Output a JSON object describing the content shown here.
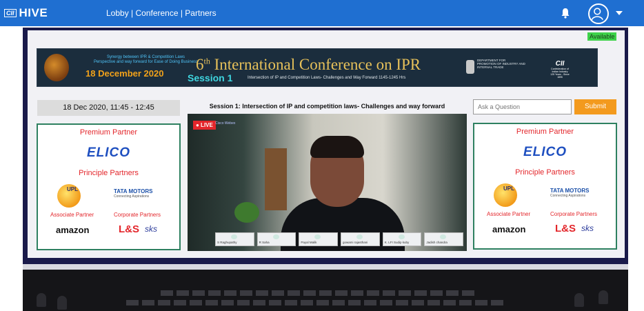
{
  "app": {
    "logo_mark": "CII",
    "logo_text": "HIVE",
    "nav": "Lobby | Conference | Partners"
  },
  "header": {
    "bell_icon": "bell-icon",
    "avatar_icon": "user-avatar-icon",
    "menu_icon": "caret-down-icon"
  },
  "status": {
    "available": "Available"
  },
  "banner": {
    "synergy_line1": "Synergy between IPR & Competition Laws",
    "synergy_line2": "Perspective and way forward for Ease of Doing Business",
    "date": "18 December 2020",
    "title_num": "6",
    "title_sup": "th",
    "title_rest": " International Conference on IPR",
    "session": "Session 1",
    "session_sub": "Intersection of IP and Competition Laws- Challenges and Way Forward 1145-1245 Hrs",
    "dept_line1": "DEPARTMENT FOR",
    "dept_line2": "PROMOTION OF INDUSTRY AND",
    "dept_line3": "INTERNAL TRADE",
    "cii": "CII",
    "cii_sub1": "Confederation of Indian Industry",
    "cii_sub2": "125 Years - Since 1895"
  },
  "session": {
    "datetime": "18 Dec 2020, 11:45 - 12:45",
    "title": "Session 1: Intersection of IP and competition laws- Challenges and way forward"
  },
  "qa": {
    "placeholder": "Ask a Question",
    "submit_label": "Submit"
  },
  "video": {
    "live_label": "● LIVE",
    "webex_text": "Cisco Webex",
    "tiles": [
      "S Raghupathy",
      "R Saha",
      "Payal Malik",
      "gowami rajasthani",
      "K. LFI Sudip kuby",
      "Jadish chandra",
      ""
    ]
  },
  "partners": {
    "premium_title": "Premium Partner",
    "premium_name": "ELICO",
    "principle_title": "Principle Partners",
    "upl": "UPL",
    "tata": "TATA MOTORS",
    "tata_sub": "Connecting Aspirations",
    "associate_title": "Associate Partner",
    "corporate_title": "Corporate Partners",
    "amazon": "amazon",
    "lns": "L&S",
    "sks": "sks"
  },
  "colors": {
    "nav_blue": "#1f6fd1",
    "accent_red": "#e3262b",
    "submit_orange": "#f39a1e",
    "available_green": "#3ed24a",
    "border_green": "#2e8060"
  }
}
